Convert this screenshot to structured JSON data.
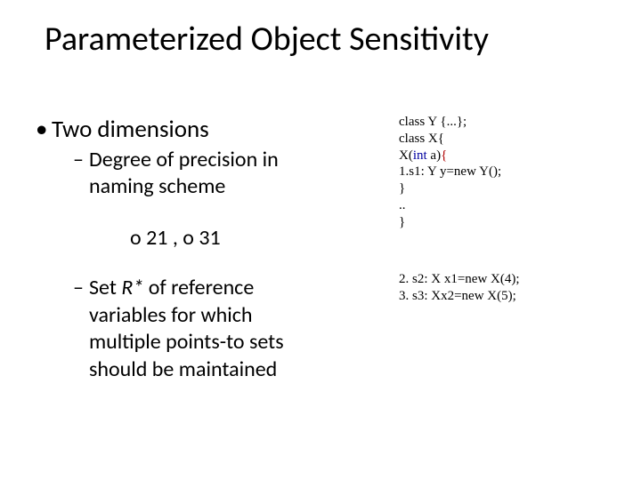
{
  "title": "Parameterized Object Sensitivity",
  "body": {
    "top": "Two dimensions",
    "sub1_line1": "Degree of precision in",
    "sub1_line2": "naming scheme",
    "example": "o 21 , o 31",
    "sub2_line1_prefix": "Set ",
    "sub2_line1_rstar": "R*",
    "sub2_line1_suffix": " of reference",
    "sub2_line2": "variables for which",
    "sub2_line3": "multiple points-to sets",
    "sub2_line4": "should be maintained"
  },
  "code": {
    "l1": "class Y {...};",
    "l2": "class X{",
    "l3_a": "X(",
    "l3_b": "int",
    "l3_c": " a)",
    "l3_d": "{",
    "l4": "1.s1: Y y=new Y();",
    "l5": "}",
    "l6": "..",
    "l7": "}",
    "l8": "2. s2: X x1=new X(4);",
    "l9": "3. s3: Xx2=new X(5);"
  }
}
